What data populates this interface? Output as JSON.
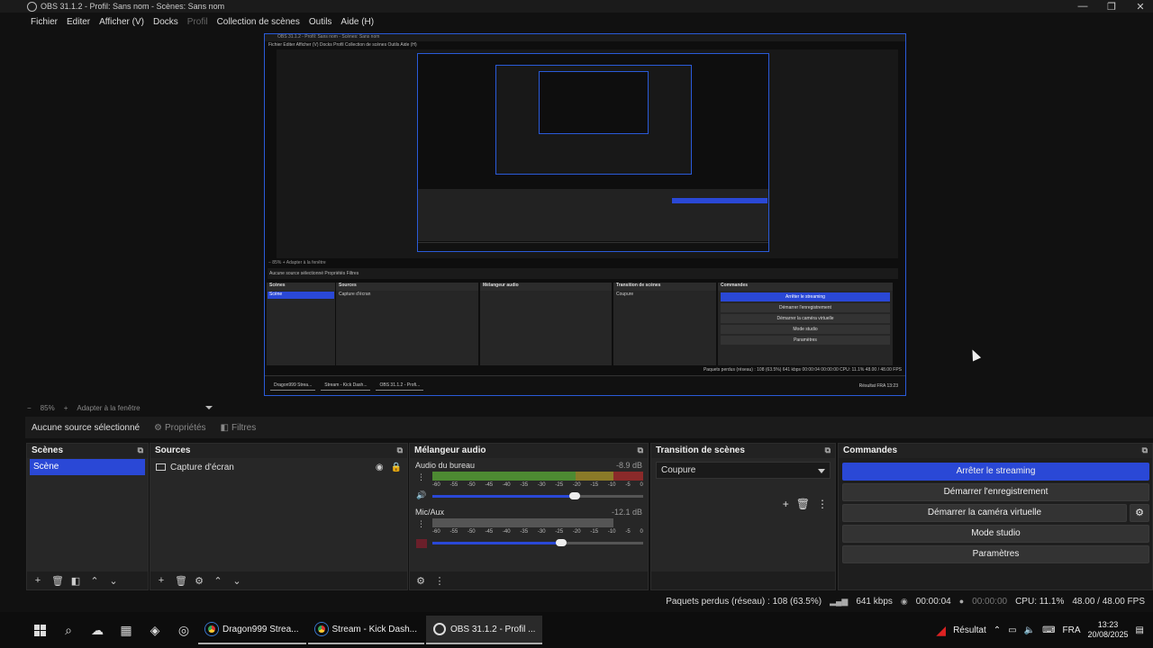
{
  "window": {
    "title": "OBS 31.1.2 - Profil: Sans nom - Scènes: Sans nom",
    "controls": {
      "minimize": "—",
      "maximize": "❐",
      "close": "✕"
    }
  },
  "menu": {
    "items": [
      "Fichier",
      "Editer",
      "Afficher (V)",
      "Docks",
      "Profil",
      "Collection de scènes",
      "Outils",
      "Aide (H)"
    ]
  },
  "nested": {
    "title": "OBS 31.1.2 - Profil: Sans nom - Scènes: Sans nom",
    "menu": "Fichier   Editer   Afficher (V)   Docks   Profil   Collection de scènes   Outils   Aide (H)",
    "zoom": "− 85% +   Adapter à la fenêtre",
    "toolbar": "Aucune source sélectionné      Propriétés      Filtres",
    "scenes_header": "Scènes",
    "scene": "Scène",
    "sources_header": "Sources",
    "source": "Capture d'écran",
    "mixer_header": "Mélangeur audio",
    "transitions_header": "Transition de scènes",
    "transition": "Coupure",
    "controls_header": "Commandes",
    "controls": [
      "Arrêter le streaming",
      "Démarrer l'enregistrement",
      "Démarrer la caméra virtuelle",
      "Mode studio",
      "Paramètres"
    ],
    "status": "Paquets perdus (réseau) : 108 (63.5%)   641 kbps   00:00:04   00:00:00   CPU: 11.1%   48.00 / 48.00 FPS",
    "taskbar": [
      "Dragon999 Strea...",
      "Stream - Kick Dash...",
      "OBS 31.1.2 - Profi..."
    ],
    "tray": "Résultat   FRA   13:23"
  },
  "zoombar": {
    "minus": "−",
    "zoom": "85%",
    "plus": "+",
    "fit": "Adapter à la fenêtre"
  },
  "source_toolbar": {
    "no_source": "Aucune source sélectionné",
    "properties": "Propriétés",
    "filters": "Filtres"
  },
  "scenes": {
    "header": "Scènes",
    "items": [
      "Scène"
    ]
  },
  "sources": {
    "header": "Sources",
    "items": [
      {
        "name": "Capture d'écran",
        "visible": true,
        "locked": false
      }
    ]
  },
  "mixer": {
    "header": "Mélangeur audio",
    "scale": [
      "-60",
      "-55",
      "-50",
      "-45",
      "-40",
      "-35",
      "-30",
      "-25",
      "-20",
      "-15",
      "-10",
      "-5",
      "0"
    ],
    "channels": [
      {
        "name": "Audio du bureau",
        "db": "-8.9 dB",
        "level": 0.86,
        "volume": 0.68,
        "muted": false
      },
      {
        "name": "Mic/Aux",
        "db": "-12.1 dB",
        "level": 0.86,
        "volume": 0.61,
        "muted": true
      }
    ]
  },
  "transitions": {
    "header": "Transition de scènes",
    "selected": "Coupure"
  },
  "controls": {
    "header": "Commandes",
    "stop_stream": "Arrêter le streaming",
    "start_record": "Démarrer l'enregistrement",
    "virtual_cam": "Démarrer la caméra virtuelle",
    "studio_mode": "Mode studio",
    "settings": "Paramètres"
  },
  "status": {
    "dropped": "Paquets perdus (réseau) : 108 (63.5%)",
    "bitrate": "641 kbps",
    "stream_time": "00:00:04",
    "record_time": "00:00:00",
    "cpu": "CPU: 11.1%",
    "fps": "48.00 / 48.00 FPS"
  },
  "taskbar": {
    "apps": [
      {
        "label": "Dragon999 Strea...",
        "icon": "chrome-icon"
      },
      {
        "label": "Stream - Kick Dash...",
        "icon": "chrome-icon"
      },
      {
        "label": "OBS 31.1.2 - Profil ...",
        "icon": "obs-icon"
      }
    ],
    "tray_label": "Résultat",
    "lang": "FRA",
    "time": "13:23",
    "date": "20/08/2025"
  },
  "colors": {
    "accent": "#2a48d6",
    "bg": "#111111",
    "panel": "#272727"
  }
}
